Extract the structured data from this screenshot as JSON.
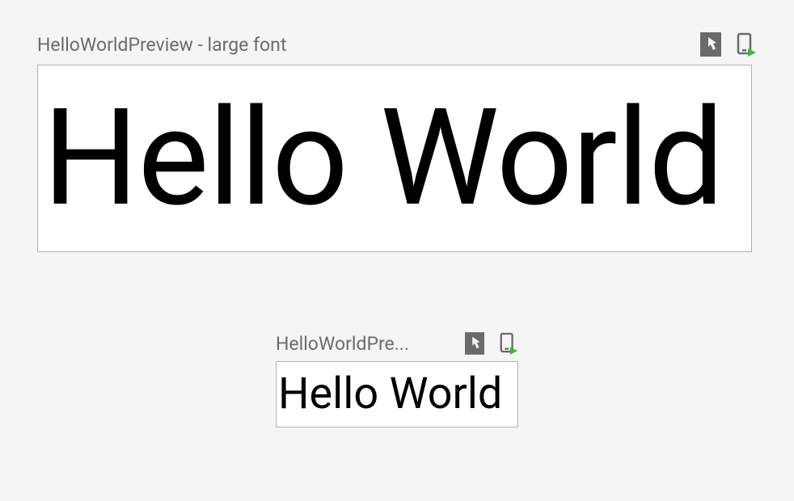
{
  "previews": [
    {
      "title": "HelloWorldPreview - large font",
      "content": "Hello World"
    },
    {
      "title": "HelloWorldPre...",
      "content": "Hello World"
    }
  ],
  "icons": {
    "interactive": "interactive-mode-icon",
    "deploy": "deploy-preview-icon"
  }
}
